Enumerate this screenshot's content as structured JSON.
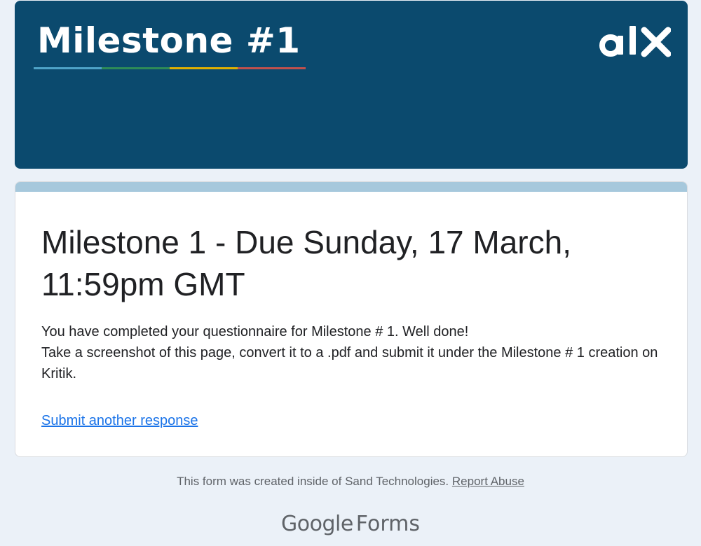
{
  "banner": {
    "title": "Milestone #1",
    "brand_icon": "alx-logo",
    "stripe_colors": [
      "#4fa3c7",
      "#2e8b57",
      "#e0b000",
      "#c0504d"
    ],
    "background": "#0b4a6e"
  },
  "card": {
    "accent_color": "#a6c8dc",
    "title": "Milestone 1 - Due Sunday, 17 March, 11:59pm GMT",
    "message_line_1": "You have completed your questionnaire for Milestone # 1. Well done!",
    "message_line_2": "Take a screenshot of this page, convert it to a .pdf and submit it under the Milestone # 1 creation on Kritik.",
    "submit_another_label": "Submit another response"
  },
  "footer": {
    "created_text": "This form was created inside of Sand Technologies.",
    "report_abuse_label": "Report Abuse",
    "logo_google": "Google",
    "logo_forms": "Forms"
  }
}
